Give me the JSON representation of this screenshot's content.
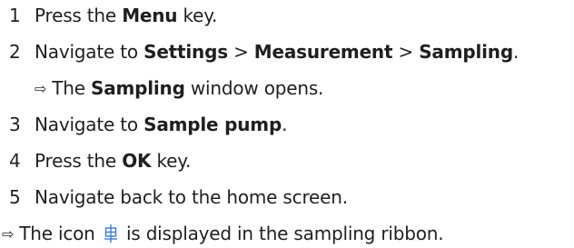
{
  "steps": [
    {
      "num": "1",
      "pre": "Press the ",
      "b1": "Menu",
      "post": " key."
    },
    {
      "num": "2",
      "pre": "Navigate to ",
      "b1": "Settings",
      "sep1": " > ",
      "b2": "Measurement",
      "sep2": " > ",
      "b3": "Sampling",
      "post": "."
    },
    {
      "num": "3",
      "pre": "Navigate to ",
      "b1": "Sample pump",
      "post": "."
    },
    {
      "num": "4",
      "pre": "Press the ",
      "b1": "OK",
      "post": " key."
    },
    {
      "num": "5",
      "text": "Navigate back to the home screen."
    }
  ],
  "result_step2": {
    "arrow": "⇨",
    "pre": "The ",
    "b1": "Sampling",
    "post": " window opens."
  },
  "final": {
    "arrow": "⇨",
    "pre": "The icon ",
    "icon": "sample-pump-icon",
    "post": " is displayed in the sampling ribbon."
  },
  "colors": {
    "text": "#1f1f1f",
    "icon": "#3a7bd5"
  }
}
